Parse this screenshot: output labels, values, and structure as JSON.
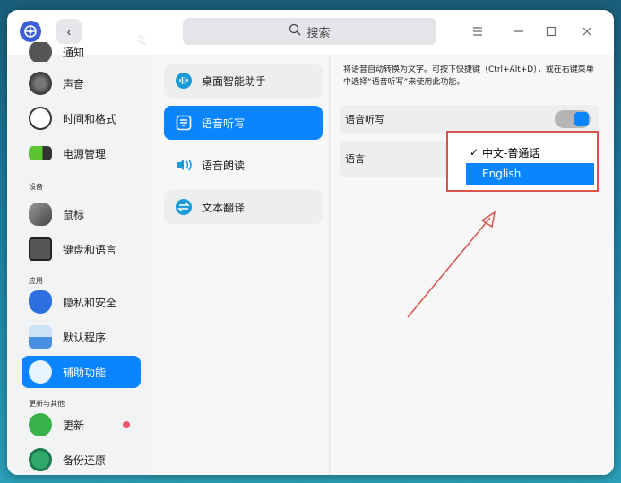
{
  "titlebar": {
    "search_placeholder": "搜索",
    "menu_icon": "menu-icon",
    "minimize_icon": "minimize-icon",
    "maximize_icon": "maximize-icon",
    "close_icon": "close-icon"
  },
  "sidebar": {
    "partial_item": "通知",
    "items_top": [
      {
        "label": "声音",
        "icon": "speaker-icon"
      },
      {
        "label": "时间和格式",
        "icon": "clock-icon"
      },
      {
        "label": "电源管理",
        "icon": "battery-icon"
      }
    ],
    "group_devices": "设备",
    "items_devices": [
      {
        "label": "鼠标",
        "icon": "mouse-icon"
      },
      {
        "label": "键盘和语言",
        "icon": "keyboard-icon"
      }
    ],
    "group_apps": "应用",
    "items_apps": [
      {
        "label": "隐私和安全",
        "icon": "shield-icon"
      },
      {
        "label": "默认程序",
        "icon": "default-apps-icon"
      },
      {
        "label": "辅助功能",
        "icon": "accessibility-icon",
        "active": true
      }
    ],
    "group_more": "更新与其他",
    "items_more": [
      {
        "label": "更新",
        "icon": "update-icon",
        "badge": true
      },
      {
        "label": "备份还原",
        "icon": "backup-icon"
      }
    ]
  },
  "middle": {
    "items": [
      {
        "label": "桌面智能助手",
        "icon": "assistant-icon"
      },
      {
        "label": "语音听写",
        "icon": "dictation-icon",
        "active": true
      },
      {
        "label": "语音朗读",
        "icon": "speaker-read-icon"
      },
      {
        "label": "文本翻译",
        "icon": "translate-icon"
      }
    ]
  },
  "right": {
    "description": "将语音自动转换为文字。可按下快捷键（Ctrl+Alt+D），或在右键菜单中选择“语音听写”来使用此功能。",
    "dictation_label": "语音听写",
    "dictation_enabled": true,
    "language_label": "语言",
    "language_options": [
      {
        "label": "中文-普通话",
        "checked": true
      },
      {
        "label": "English",
        "highlighted": true
      }
    ]
  },
  "colors": {
    "accent": "#0a84ff",
    "annotation_red": "#d9534f"
  }
}
